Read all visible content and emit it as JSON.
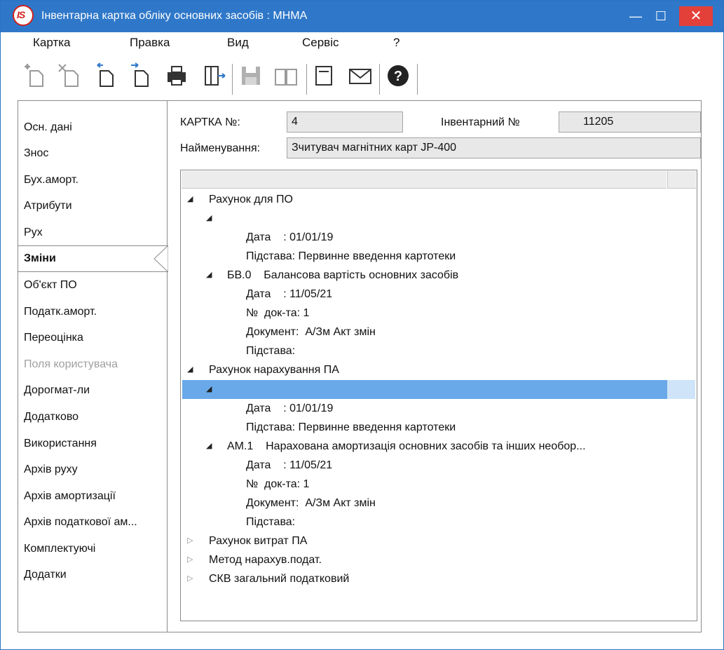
{
  "window": {
    "title": "Інвентарна картка обліку основних засобів  : МНМА",
    "minimize": "—",
    "maximize": "☐",
    "close": "✕"
  },
  "menu": [
    "Картка",
    "Правка",
    "Вид",
    "Сервіс",
    "?"
  ],
  "toolbar": [
    "new-icon",
    "delete-icon",
    "import-icon",
    "export-icon",
    "print-icon",
    "exit-icon",
    "save-icon",
    "book-icon",
    "form-icon",
    "mail-icon",
    "help-icon"
  ],
  "sidebar": {
    "items": [
      {
        "label": "Осн. дані"
      },
      {
        "label": "Знос"
      },
      {
        "label": "Бух.аморт."
      },
      {
        "label": "Атрибути"
      },
      {
        "label": "Рух"
      },
      {
        "label": "Зміни",
        "active": true
      },
      {
        "label": "Об'єкт ПО"
      },
      {
        "label": "Податк.аморт."
      },
      {
        "label": "Переоцінка"
      },
      {
        "label": "Поля користувача",
        "disabled": true
      },
      {
        "label": "Дорогмат-ли"
      },
      {
        "label": "Додатково"
      },
      {
        "label": "Використання"
      },
      {
        "label": "Архів руху"
      },
      {
        "label": "Архів амортизації"
      },
      {
        "label": "Архів податкової ам..."
      },
      {
        "label": "Комплектуючі"
      },
      {
        "label": "Додатки"
      }
    ]
  },
  "header": {
    "card_label": "КАРТКА №:",
    "card_value": "4",
    "inv_label": "Інвентарний №",
    "inv_value": "11205",
    "name_label": "Найменування:",
    "name_value": "Зчитувач магнітних карт JP-400"
  },
  "tree": {
    "rows": [
      {
        "level": 0,
        "expander": "open",
        "text": "Рахунок для ПО"
      },
      {
        "level": 1,
        "expander": "open",
        "text": ""
      },
      {
        "level": 2,
        "text": "Дата    : 01/01/19"
      },
      {
        "level": 2,
        "text": "Підстава: Первинне введення картотеки"
      },
      {
        "level": 1,
        "expander": "open",
        "text": "БВ.0    Балансова вартість основних засобів"
      },
      {
        "level": 2,
        "text": "Дата    : 11/05/21"
      },
      {
        "level": 2,
        "text": "№  док-та: 1"
      },
      {
        "level": 2,
        "text": "Документ:  А/Зм Акт змін"
      },
      {
        "level": 2,
        "text": "Підстава:"
      },
      {
        "level": 0,
        "expander": "open",
        "text": "Рахунок нарахування ПА"
      },
      {
        "level": 1,
        "expander": "open",
        "text": "",
        "selected": true
      },
      {
        "level": 2,
        "text": "Дата    : 01/01/19"
      },
      {
        "level": 2,
        "text": "Підстава: Первинне введення картотеки"
      },
      {
        "level": 1,
        "expander": "open",
        "text": "АМ.1    Нарахована амортизація основних засобів та інших необор..."
      },
      {
        "level": 2,
        "text": "Дата    : 11/05/21"
      },
      {
        "level": 2,
        "text": "№  док-та: 1"
      },
      {
        "level": 2,
        "text": "Документ:  А/Зм Акт змін"
      },
      {
        "level": 2,
        "text": "Підстава:"
      },
      {
        "level": 0,
        "expander": "closed",
        "text": "Рахунок витрат ПА"
      },
      {
        "level": 0,
        "expander": "closed",
        "text": "Метод нарахув.подат."
      },
      {
        "level": 0,
        "expander": "closed",
        "text": "СКВ загальний податковий"
      }
    ]
  }
}
